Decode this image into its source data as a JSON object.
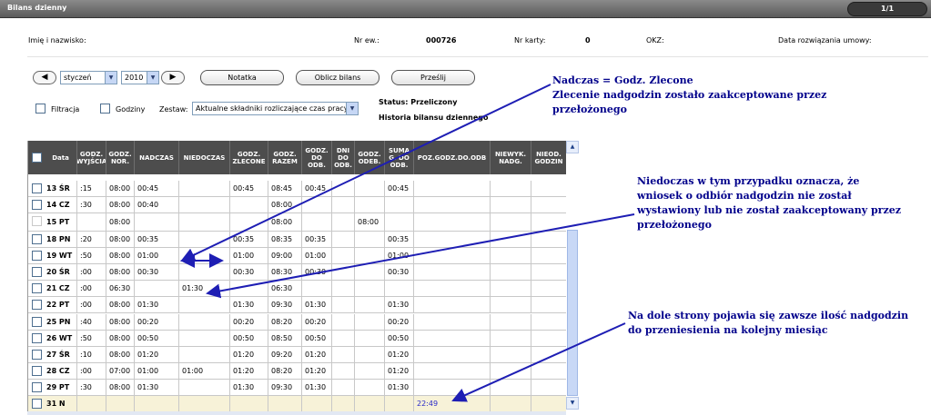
{
  "window": {
    "title": "Bilans dzienny",
    "pager": "1/1"
  },
  "employee": {
    "name_label": "Imię i nazwisko:",
    "nr_ew_label": "Nr ew.:",
    "nr_ew_value": "000726",
    "nr_karty_label": "Nr karty:",
    "nr_karty_value": "0",
    "okz_label": "OKZ:",
    "termination_label": "Data rozwiązania umowy:"
  },
  "toolbar": {
    "prev_label": "◀",
    "next_label": "▶",
    "month": "styczeń",
    "year": "2010",
    "note_button": "Notatka",
    "calc_button": "Oblicz bilans",
    "send_button": "Prześlij"
  },
  "filters": {
    "filtracja_label": "Filtracja",
    "godziny_label": "Godziny",
    "zestaw_label": "Zestaw:",
    "zestaw_value": "Aktualne składniki rozliczające czas pracy"
  },
  "status": {
    "status_text": "Status: Przeliczony",
    "history_link": "Historia bilansu dziennego"
  },
  "table": {
    "headers": [
      "Data",
      "GODZ.\nWYJŚCIA",
      "GODZ.\nNOR.",
      "NADCZAS",
      "NIEDOCZAS",
      "GODZ.\nZLECONE",
      "GODZ.\nRAZEM",
      "GODZ.\nDO\nODB.",
      "DNI\nDO\nODB.",
      "GODZ.\nODEB.",
      "SUMA\nG. DO\nODB.",
      "POZ.GODZ.DO.ODB",
      "NIEWYK.\nNADG.",
      "NIEOD.\nGODZIN"
    ],
    "rows": [
      [
        "13 ŚR",
        ":15",
        "08:00",
        "00:45",
        "",
        "00:45",
        "08:45",
        "00:45",
        "",
        "",
        "00:45",
        "",
        "",
        ""
      ],
      [
        "14 CZ",
        ":30",
        "08:00",
        "00:40",
        "",
        "",
        "08:00",
        "",
        "",
        "",
        "",
        "",
        "",
        ""
      ],
      [
        "15 PT",
        "",
        "08:00",
        "",
        "",
        "",
        "08:00",
        "",
        "",
        "08:00",
        "",
        "",
        "",
        ""
      ],
      [
        "18 PN",
        ":20",
        "08:00",
        "00:35",
        "",
        "00:35",
        "08:35",
        "00:35",
        "",
        "",
        "00:35",
        "",
        "",
        ""
      ],
      [
        "19 WT",
        ":50",
        "08:00",
        "01:00",
        "",
        "01:00",
        "09:00",
        "01:00",
        "",
        "",
        "01:00",
        "",
        "",
        ""
      ],
      [
        "20 ŚR",
        ":00",
        "08:00",
        "00:30",
        "",
        "00:30",
        "08:30",
        "00:30",
        "",
        "",
        "00:30",
        "",
        "",
        ""
      ],
      [
        "21 CZ",
        ":00",
        "06:30",
        "",
        "01:30",
        "",
        "06:30",
        "",
        "",
        "",
        "",
        "",
        "",
        ""
      ],
      [
        "22 PT",
        ":00",
        "08:00",
        "01:30",
        "",
        "01:30",
        "09:30",
        "01:30",
        "",
        "",
        "01:30",
        "",
        "",
        ""
      ],
      [
        "25 PN",
        ":40",
        "08:00",
        "00:20",
        "",
        "00:20",
        "08:20",
        "00:20",
        "",
        "",
        "00:20",
        "",
        "",
        ""
      ],
      [
        "26 WT",
        ":50",
        "08:00",
        "00:50",
        "",
        "00:50",
        "08:50",
        "00:50",
        "",
        "",
        "00:50",
        "",
        "",
        ""
      ],
      [
        "27 ŚR",
        ":10",
        "08:00",
        "01:20",
        "",
        "01:20",
        "09:20",
        "01:20",
        "",
        "",
        "01:20",
        "",
        "",
        ""
      ],
      [
        "28 CZ",
        ":00",
        "07:00",
        "01:00",
        "01:00",
        "01:20",
        "08:20",
        "01:20",
        "",
        "",
        "01:20",
        "",
        "",
        ""
      ],
      [
        "29 PT",
        ":30",
        "08:00",
        "01:30",
        "",
        "01:30",
        "09:30",
        "01:30",
        "",
        "",
        "01:30",
        "",
        "",
        ""
      ],
      [
        "31 N",
        "",
        "",
        "",
        "",
        "",
        "",
        "",
        "",
        "",
        "",
        "22:49",
        "",
        ""
      ]
    ]
  },
  "annotations": [
    {
      "lines": [
        "Nadczas = Godz. Zlecone",
        "Zlecenie nadgodzin zostało zaakceptowane przez",
        "przełożonego"
      ]
    },
    {
      "lines": [
        "Niedoczas w tym przypadku oznacza, że",
        "wniosek o odbiór nadgodzin nie został",
        "wystawiony lub nie został zaakceptowany przez",
        "przełożonego"
      ]
    },
    {
      "lines": [
        "Na dole strony pojawia się zawsze ilość nadgodzin",
        "do przeniesienia na kolejny miesiąc"
      ]
    }
  ],
  "colors": {
    "header_bg": "#4d4d4d",
    "annotation": "#00008b",
    "accent_blue": "#1e1eb4"
  },
  "scroll_icons": {
    "up": "▲",
    "down": "▼"
  },
  "dropdown_icon": "▼"
}
